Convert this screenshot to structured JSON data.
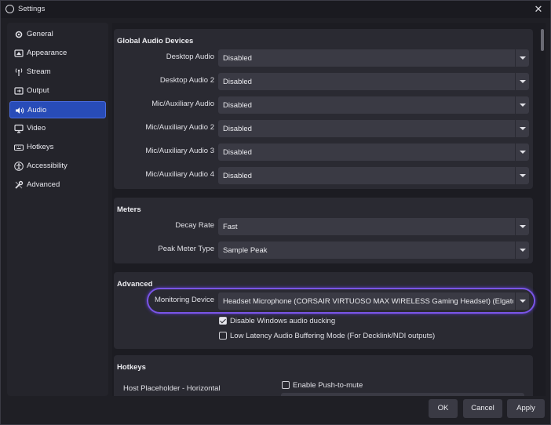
{
  "window": {
    "title": "Settings"
  },
  "sidebar": {
    "items": [
      {
        "label": "General",
        "icon": "gear-icon"
      },
      {
        "label": "Appearance",
        "icon": "appearance-icon"
      },
      {
        "label": "Stream",
        "icon": "antenna-icon"
      },
      {
        "label": "Output",
        "icon": "output-icon"
      },
      {
        "label": "Audio",
        "icon": "speaker-icon",
        "active": true
      },
      {
        "label": "Video",
        "icon": "monitor-icon"
      },
      {
        "label": "Hotkeys",
        "icon": "keyboard-icon"
      },
      {
        "label": "Accessibility",
        "icon": "accessibility-icon"
      },
      {
        "label": "Advanced",
        "icon": "wrench-icon"
      }
    ]
  },
  "global_audio": {
    "title": "Global Audio Devices",
    "rows": [
      {
        "label": "Desktop Audio",
        "value": "Disabled"
      },
      {
        "label": "Desktop Audio 2",
        "value": "Disabled"
      },
      {
        "label": "Mic/Auxiliary Audio",
        "value": "Disabled"
      },
      {
        "label": "Mic/Auxiliary Audio 2",
        "value": "Disabled"
      },
      {
        "label": "Mic/Auxiliary Audio 3",
        "value": "Disabled"
      },
      {
        "label": "Mic/Auxiliary Audio 4",
        "value": "Disabled"
      }
    ]
  },
  "meters": {
    "title": "Meters",
    "rows": [
      {
        "label": "Decay Rate",
        "value": "Fast"
      },
      {
        "label": "Peak Meter Type",
        "value": "Sample Peak"
      }
    ]
  },
  "advanced": {
    "title": "Advanced",
    "monitoring_label": "Monitoring Device",
    "monitoring_value": "Headset Microphone (CORSAIR VIRTUOSO MAX WIRELESS Gaming Headset) (Elgato Vi",
    "checks": [
      {
        "label": "Disable Windows audio ducking",
        "checked": true
      },
      {
        "label": "Low Latency Audio Buffering Mode (For Decklink/NDI outputs)",
        "checked": false
      }
    ]
  },
  "hotkeys": {
    "title": "Hotkeys",
    "source_label": "Host Placeholder - Horizontal",
    "push_to_mute": "Enable Push-to-mute"
  },
  "footer": {
    "ok": "OK",
    "cancel": "Cancel",
    "apply": "Apply"
  },
  "colors": {
    "accent": "#284cb8",
    "highlight": "#7a55e6"
  }
}
